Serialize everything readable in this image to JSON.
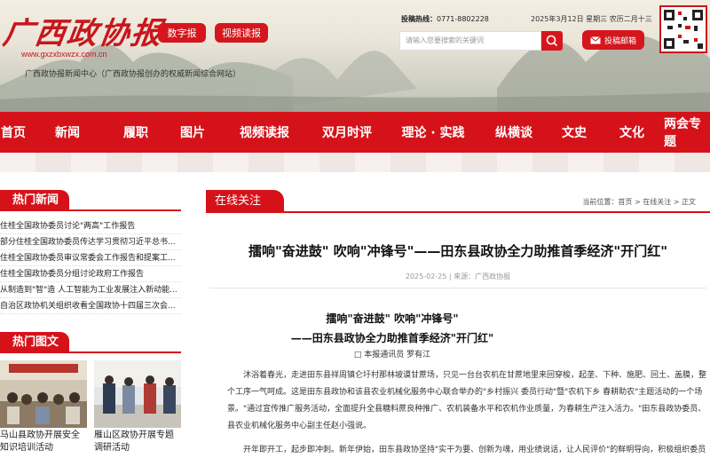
{
  "header": {
    "logo_text": "广西政协报",
    "logo_url": "www.gxzxbxwzx.com.cn",
    "site_desc": "广西政协报新闻中心（广西政协报创办的权威新闻综合网站）",
    "btn_digital": "数字报",
    "btn_video": "视频读报",
    "hotline_label": "投稿热线：",
    "hotline_number": "0771-8802228",
    "date_text": "2025年3月12日 星期三 农历二月十三",
    "search_placeholder": "请输入您要搜索的关键词",
    "mail_btn": "投稿邮箱",
    "colors": {
      "brand_red": "#d5121a"
    }
  },
  "nav": {
    "items": [
      "首页",
      "新闻",
      "履职",
      "图片",
      "视频读报",
      "双月时评",
      "理论 · 实践",
      "纵横谈",
      "文史",
      "文化",
      "两会专题"
    ]
  },
  "left": {
    "hot_news_title": "热门新闻",
    "hot_news": [
      "住桂全国政协委员讨论\"两高\"工作报告",
      "部分住桂全国政协委员传达学习贯彻习近平总书...",
      "住桂全国政协委员审议常委会工作报告和提案工...",
      "住桂全国政协委员分组讨论政府工作报告",
      "从制造到\"智\"造 人工智能为工业发展注入新动能...",
      "自治区政协机关组织收看全国政协十四届三次会..."
    ],
    "hot_pics_title": "热门图文",
    "hot_pics": [
      {
        "caption": "马山县政协开展安全知识培训活动"
      },
      {
        "caption": "雁山区政协开展专题调研活动"
      }
    ]
  },
  "main": {
    "tab_label": "在线关注",
    "breadcrumb": "当前位置：首页 > 在线关注 > 正文",
    "title": "擂响\"奋进鼓\" 吹响\"冲锋号\"——田东县政协全力助推首季经济\"开门红\"",
    "meta": "2025-02-25 | 来源：广西政协报",
    "subtitle1": "擂响\"奋进鼓\" 吹响\"冲锋号\"",
    "subtitle2": "——田东县政协全力助推首季经济\"开门红\"",
    "byline": "□ 本报通讯员 罗有江",
    "paragraph1": "沐浴着春光，走进田东县祥周镇仑圩村那林坡谟甘蔗场，只见一台台农机在甘蔗地里来回穿梭，起垄、下种、施肥、回土、盖膜，整个工序一气呵成。这是田东县政协和该县农业机械化服务中心联合举办的\"乡村振兴 委员行动\"暨\"农机下乡 春耕助农\"主题活动的一个场景。\"通过宣传推广服务活动，全面提升全县糖料蔗良种推广、农机装备水平和农机作业质量，为春耕生产注入活力。\"田东县政协委员、县农业机械化服务中心副主任赵小强说。",
    "paragraph2": "开年即开工，起步即冲刺。新年伊始，田东县政协坚持\"实干为要、创新为魂，用业绩说话，让人民评价\"的鲜明导向，积极组织委员认"
  }
}
